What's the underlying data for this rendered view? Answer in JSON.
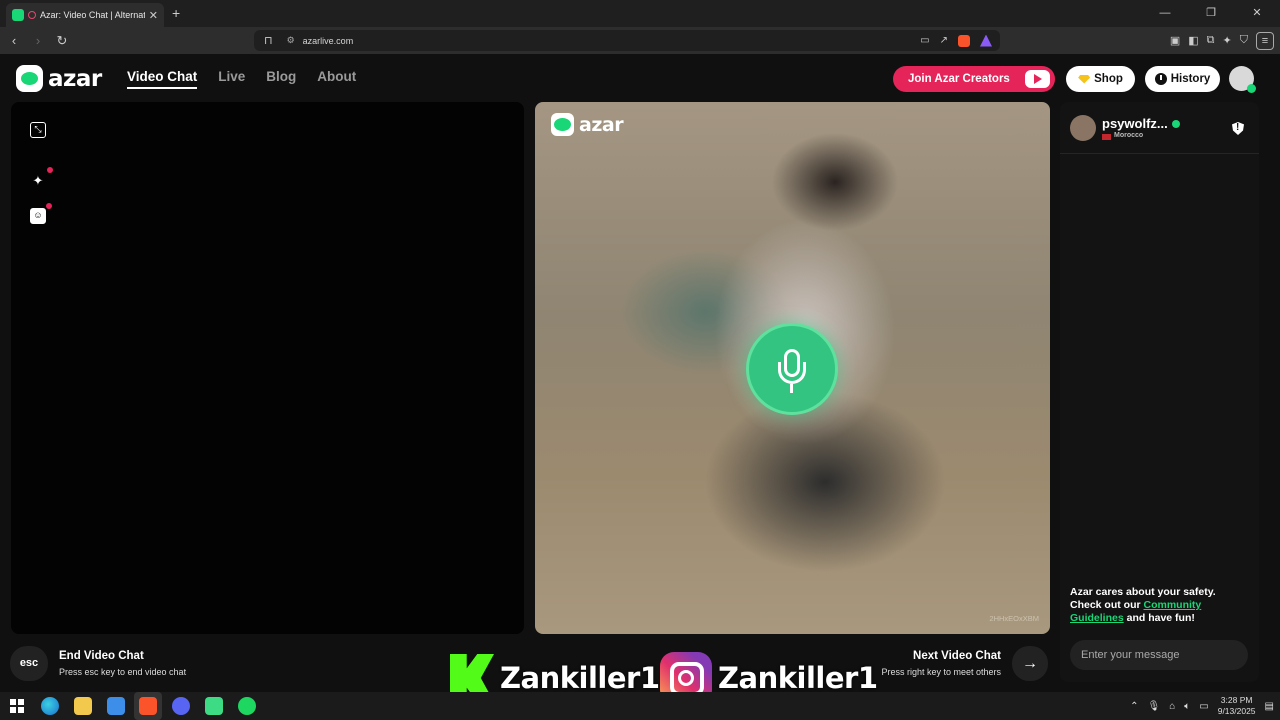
{
  "browser": {
    "tab_title": "Azar: Video Chat | Alternative",
    "tab_close": "✕",
    "new_tab": "+",
    "url": "azarlive.com",
    "window_controls": [
      "—",
      "❐",
      "✕"
    ]
  },
  "site": {
    "logo_text": "azar",
    "nav": [
      {
        "label": "Video Chat",
        "active": true
      },
      {
        "label": "Live",
        "active": false
      },
      {
        "label": "Blog",
        "active": false
      },
      {
        "label": "About",
        "active": false
      }
    ],
    "creators_button": "Join Azar Creators",
    "shop_button": "Shop",
    "history_button": "History"
  },
  "video": {
    "logo_text": "azar",
    "watermark": "2HHxEOxXBM"
  },
  "chat": {
    "peer_name": "psywolfz...",
    "peer_country": "Morocco",
    "safety_text_1": "Azar cares about your safety. Check out our ",
    "safety_link": "Community Guidelines",
    "safety_text_2": " and have fun!",
    "input_placeholder": "Enter your message"
  },
  "footer": {
    "esc_label": "esc",
    "end_title": "End Video Chat",
    "end_sub": "Press esc key to end video chat",
    "next_title": "Next Video Chat",
    "next_sub": "Press right key to meet others",
    "next_arrow": "→"
  },
  "overlay": {
    "kick_handle": "Zankiller1",
    "instagram_handle": "Zankiller1"
  },
  "taskbar": {
    "time": "3:28 PM",
    "date": "9/13/2025"
  },
  "colors": {
    "brand_green": "#19d676",
    "creators_pink": "#e5245a"
  }
}
